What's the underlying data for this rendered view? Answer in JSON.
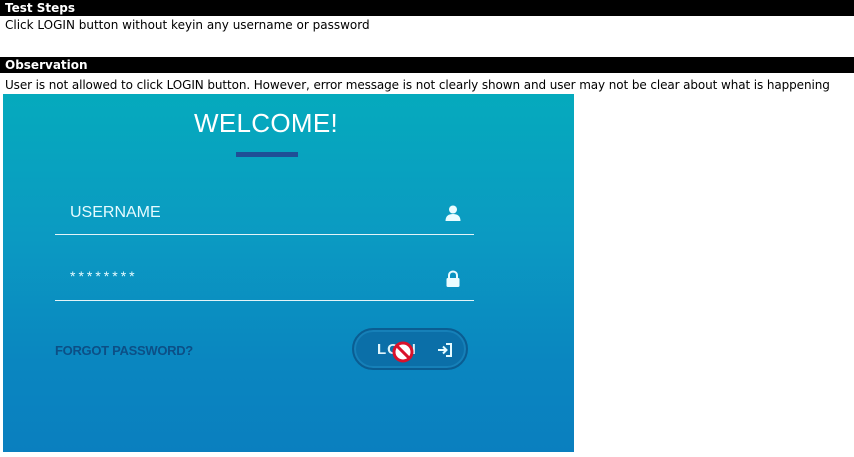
{
  "test_steps": {
    "header": "Test Steps",
    "text": "Click LOGIN button without keyin any username or password"
  },
  "observation": {
    "header": "Observation",
    "text": "User is not allowed to click LOGIN button. However, error message is not clearly shown and user may not be clear about what is happening"
  },
  "screenshot": {
    "title": "WELCOME!",
    "username": {
      "placeholder": "USERNAME",
      "icon": "user-icon"
    },
    "password": {
      "value": "********",
      "icon": "lock-icon"
    },
    "forgot_password": "FORGOT PASSWORD?",
    "login_button": {
      "label": "LO  N",
      "icon": "sign-in-icon"
    },
    "cursor": "not-allowed-cursor-icon",
    "colors": {
      "gradient_top": "#05aabd",
      "gradient_bottom": "#0a7fbf",
      "accent_bar": "#1f4f96",
      "button_bg": "#0b6fa8",
      "forgot_text": "#0c4f86",
      "cursor_red": "#d9122b"
    }
  }
}
